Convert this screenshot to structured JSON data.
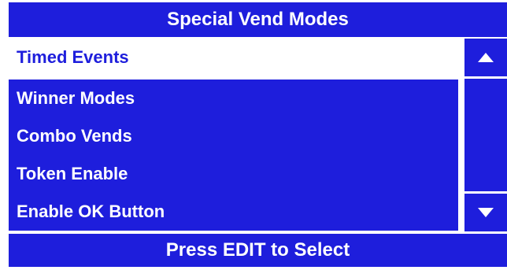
{
  "colors": {
    "background": "#ffffff",
    "panel": "#1e1edc",
    "text": "#ffffff",
    "selected_bg": "#ffffff",
    "selected_text": "#1e1edc"
  },
  "header": {
    "title": "Special Vend Modes"
  },
  "menu": {
    "selected_index": 0,
    "items": [
      {
        "label": "Timed Events"
      },
      {
        "label": "Winner Modes"
      },
      {
        "label": "Combo Vends"
      },
      {
        "label": "Token Enable"
      },
      {
        "label": "Enable OK Button"
      }
    ]
  },
  "scrollbar": {
    "up_icon": "triangle-up-icon",
    "down_icon": "triangle-down-icon"
  },
  "footer": {
    "hint": "Press EDIT to Select"
  }
}
